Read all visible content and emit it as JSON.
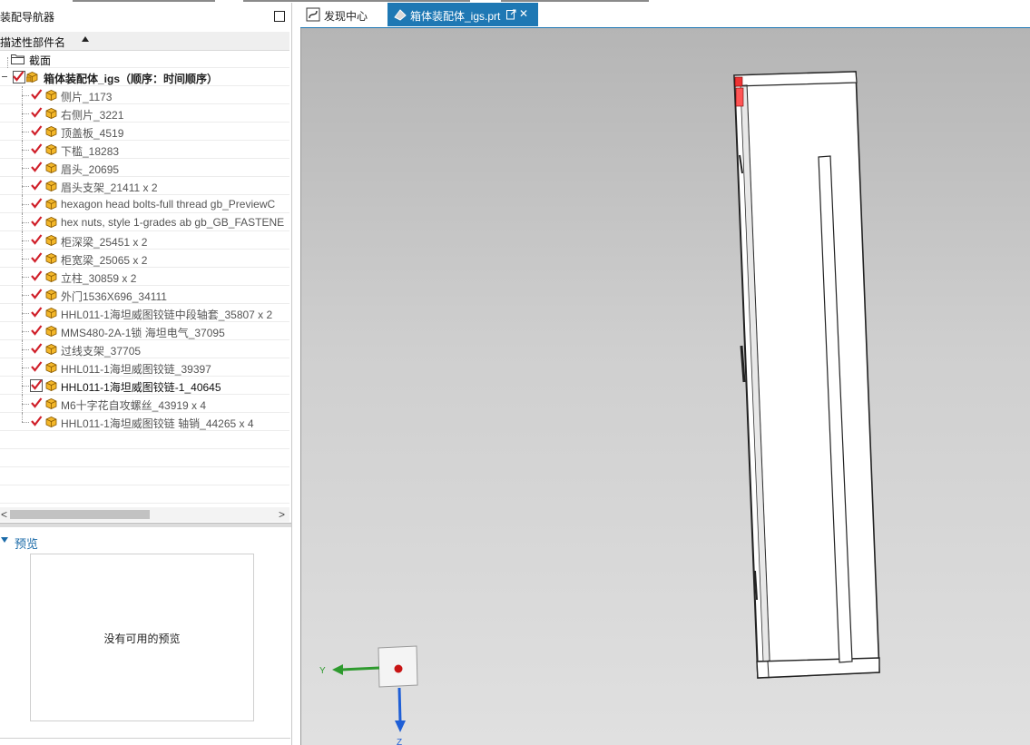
{
  "navigator": {
    "title": "装配导航器",
    "column_header": "描述性部件名",
    "section_item": "截面",
    "root_item": "箱体装配体_igs（顺序：时间顺序）",
    "items": [
      "侧片_1173",
      "右侧片_3221",
      "顶盖板_4519",
      "下槛_18283",
      "眉头_20695",
      "眉头支架_21411 x 2",
      "hexagon head bolts-full thread gb_PreviewC",
      "hex nuts, style 1-grades ab gb_GB_FASTENE",
      "柜深梁_25451 x 2",
      "柜宽梁_25065 x 2",
      "立柱_30859 x 2",
      "外门1536X696_34111",
      "HHL011-1海坦威图铰链中段轴套_35807 x 2",
      "MMS480-2A-1锁  海坦电气_37095",
      "过线支架_37705",
      "HHL011-1海坦威图铰链_39397",
      "HHL011-1海坦威图铰链-1_40645",
      "M6十字花自攻螺丝_43919 x 4",
      "HHL011-1海坦威图铰链  轴销_44265 x 4"
    ],
    "scroll_left": "<",
    "scroll_right": ">"
  },
  "preview": {
    "title": "预览",
    "empty_text": "没有可用的预览"
  },
  "tabs": [
    {
      "label": "发现中心"
    },
    {
      "label": "箱体装配体_igs.prt"
    }
  ],
  "tab_close": "✕",
  "axes": {
    "y_label": "Y",
    "z_label": "Z"
  },
  "colors": {
    "accent": "#1e78b4",
    "check": "#d0202a",
    "axis_y": "#2e9a2e",
    "axis_z": "#1f5fd6"
  }
}
